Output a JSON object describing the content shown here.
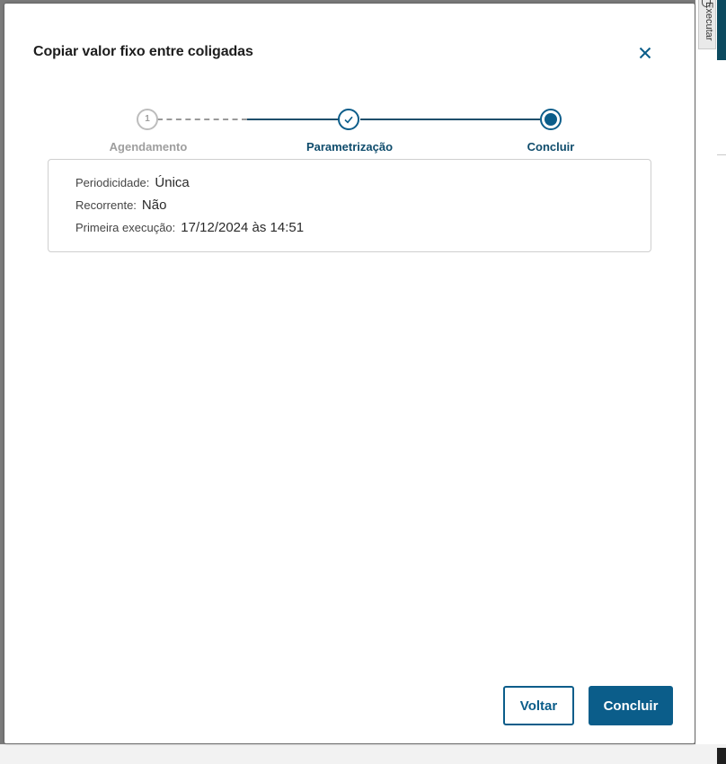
{
  "background": {
    "side_tab_label": "Executar"
  },
  "dialog": {
    "title": "Copiar valor fixo entre coligadas",
    "close_icon": "close-icon"
  },
  "stepper": {
    "steps": [
      {
        "number": "1",
        "label": "Agendamento",
        "state": "pending"
      },
      {
        "label": "Parametrização",
        "state": "done"
      },
      {
        "label": "Concluir",
        "state": "active"
      }
    ]
  },
  "summary": {
    "rows": [
      {
        "label": "Periodicidade:",
        "value": "Única"
      },
      {
        "label": "Recorrente:",
        "value": "Não"
      },
      {
        "label": "Primeira execução:",
        "value": "17/12/2024 às 14:51"
      }
    ]
  },
  "footer": {
    "back_label": "Voltar",
    "finish_label": "Concluir"
  },
  "colors": {
    "primary": "#0b5d8a",
    "pending": "#bdbdbd",
    "connector": "#1f4f6b"
  }
}
